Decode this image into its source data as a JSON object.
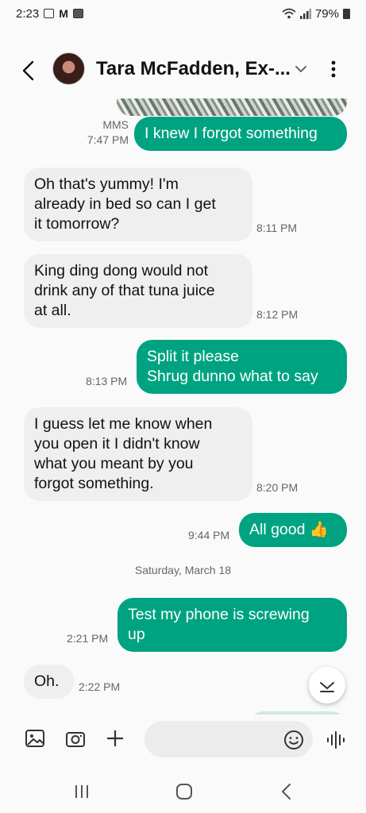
{
  "status": {
    "time": "2:23",
    "battery": "79%"
  },
  "header": {
    "contact_name": "Tara McFadden, Ex-..."
  },
  "messages": [
    {
      "dir": "out",
      "meta": "MMS",
      "time": "7:47 PM",
      "lines": [
        "I knew I forgot something"
      ]
    },
    {
      "dir": "in",
      "time": "8:11 PM",
      "lines": [
        "Oh that's yummy! I'm",
        "already in bed so can I get",
        "it tomorrow?"
      ]
    },
    {
      "dir": "in",
      "time": "8:12 PM",
      "lines": [
        "King ding dong would not",
        "drink any of that tuna juice",
        "at all."
      ]
    },
    {
      "dir": "out",
      "time": "8:13 PM",
      "lines": [
        "Split it please",
        "Shrug dunno what to say"
      ]
    },
    {
      "dir": "in",
      "time": "8:20 PM",
      "lines": [
        "I guess let me know when",
        "you open it I didn't know",
        "what you meant by you",
        "forgot something."
      ]
    },
    {
      "dir": "out",
      "time": "9:44 PM",
      "lines": [
        "All good 👍"
      ]
    },
    {
      "dir": "out",
      "time": "2:21 PM",
      "lines": [
        "Test my phone is screwing",
        "up"
      ]
    },
    {
      "dir": "in",
      "time": "2:22 PM",
      "lines": [
        "Oh."
      ]
    }
  ],
  "date_separator": "Saturday, March 18",
  "composer": {
    "placeholder": ""
  },
  "icons": {
    "back": "back-arrow-icon",
    "more": "more-vertical-icon",
    "expand": "chevron-down-icon",
    "gallery": "image-icon",
    "camera": "camera-icon",
    "add": "plus-icon",
    "emoji": "emoji-icon",
    "voice": "voice-wave-icon"
  },
  "colors": {
    "outgoing": "#00a381",
    "incoming": "#efefef",
    "background": "#fafafa"
  }
}
